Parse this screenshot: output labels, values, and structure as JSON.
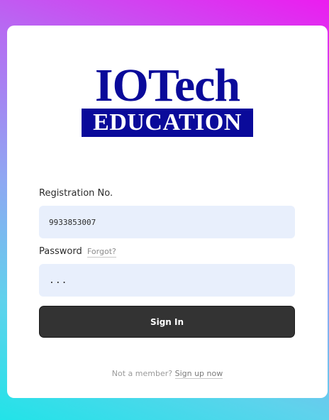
{
  "logo": {
    "title": "IOTech",
    "subtitle": "EDUCATION",
    "brand_color": "#0a0a9a"
  },
  "form": {
    "registration_label": "Registration No.",
    "registration_value": "9933853007",
    "password_label": "Password",
    "forgot_link": "Forgot?",
    "password_value": "...",
    "submit_label": "Sign In"
  },
  "footer": {
    "prompt": "Not a member?",
    "signup_link": "Sign up now"
  },
  "colors": {
    "background_gradient": [
      "#ec1cf0",
      "#b56cf2",
      "#8fa7f2",
      "#5fd2ec",
      "#22e3e8"
    ],
    "field_background": "#e8effc",
    "button_background": "#333333"
  }
}
